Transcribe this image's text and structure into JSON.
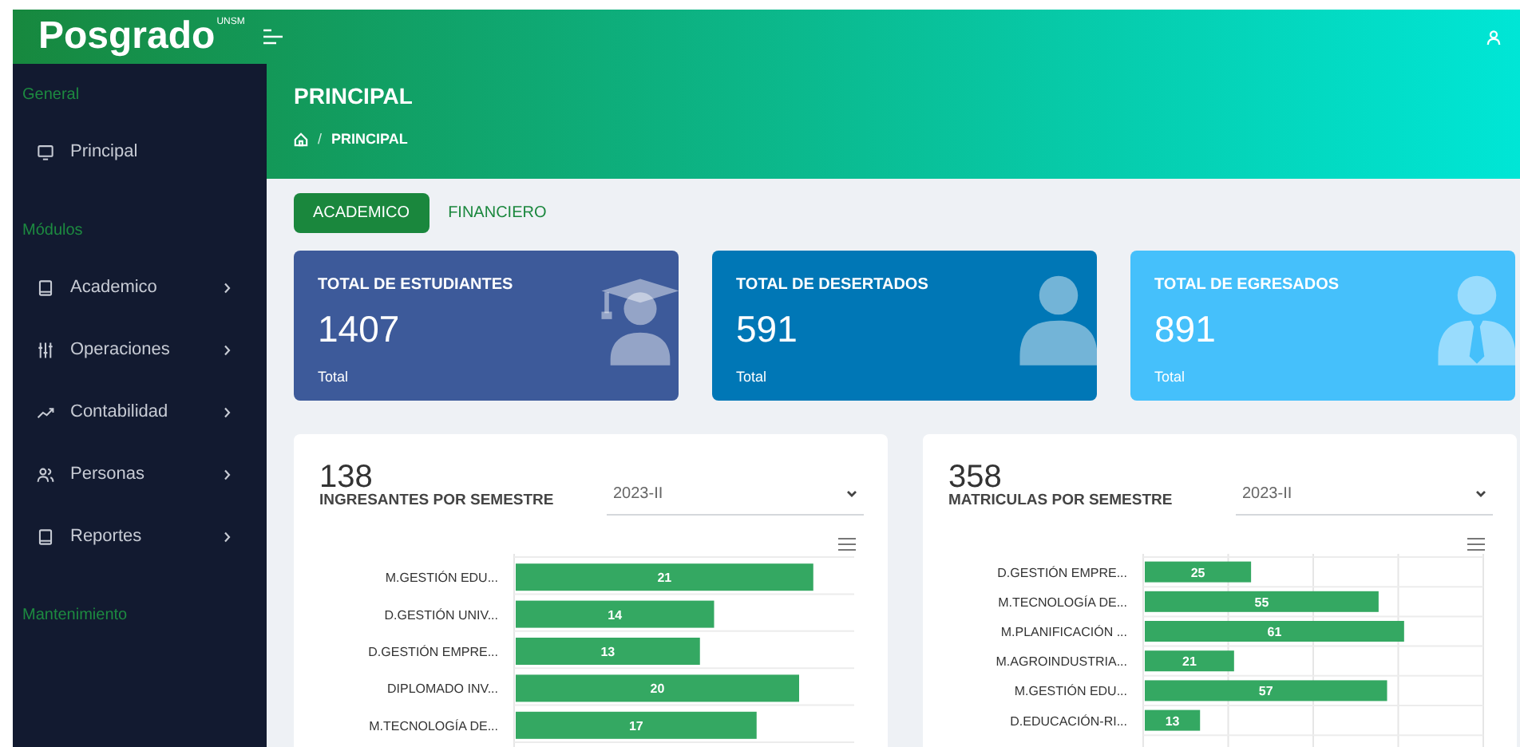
{
  "header": {
    "logo": "Posgrado",
    "logo_mark": "UNSM"
  },
  "sidebar": {
    "sections": [
      {
        "title": "General",
        "items": [
          {
            "label": "Principal",
            "has_submenu": false
          }
        ]
      },
      {
        "title": "Módulos",
        "items": [
          {
            "label": "Academico",
            "has_submenu": true
          },
          {
            "label": "Operaciones",
            "has_submenu": true
          },
          {
            "label": "Contabilidad",
            "has_submenu": true
          },
          {
            "label": "Personas",
            "has_submenu": true
          },
          {
            "label": "Reportes",
            "has_submenu": true
          }
        ]
      },
      {
        "title": "Mantenimiento"
      }
    ]
  },
  "page": {
    "title": "PRINCIPAL",
    "breadcrumb_separator": "/",
    "breadcrumb": [
      "PRINCIPAL"
    ]
  },
  "tabs": [
    {
      "label": "ACADEMICO",
      "selected": true
    },
    {
      "label": "FINANCIERO",
      "selected": false
    }
  ],
  "stats": [
    {
      "title": "TOTAL DE ESTUDIANTES",
      "value": "1407",
      "caption": "Total",
      "color": "#3d5a9a"
    },
    {
      "title": "TOTAL DE DESERTADOS",
      "value": "591",
      "caption": "Total",
      "color": "#0077b6"
    },
    {
      "title": "TOTAL DE EGRESADOS",
      "value": "891",
      "caption": "Total",
      "color": "#45c0fb"
    }
  ],
  "charts": [
    {
      "count": "138",
      "title": "INGRESANTES POR SEMESTRE",
      "select": {
        "value": "2023-II"
      },
      "chart_data": {
        "type": "bar",
        "orientation": "horizontal",
        "categories": [
          "M.GESTIÓN EDU...",
          "D.GESTIÓN UNIV...",
          "D.GESTIÓN EMPRE...",
          "DIPLOMADO INV...",
          "M.TECNOLOGÍA DE..."
        ],
        "series": [
          {
            "color": "#34a862",
            "values": [
              21,
              14,
              13,
              20,
              17
            ]
          }
        ],
        "xlim": [
          0,
          24
        ],
        "data_labels": true
      }
    },
    {
      "count": "358",
      "title": "MATRICULAS POR SEMESTRE",
      "select": {
        "value": "2023-II"
      },
      "chart_data": {
        "type": "bar",
        "orientation": "horizontal",
        "categories": [
          "D.GESTIÓN EMPRE...",
          "M.TECNOLOGÍA DE...",
          "M.PLANIFICACIÓN ...",
          "M.AGROINDUSTRIA...",
          "M.GESTIÓN EDU...",
          "D.EDUCACIÓN-RI..."
        ],
        "series": [
          {
            "color": "#34a862",
            "values": [
              25,
              55,
              61,
              21,
              57,
              13
            ]
          }
        ],
        "xlim": [
          0,
          80
        ],
        "data_labels": true
      }
    }
  ]
}
